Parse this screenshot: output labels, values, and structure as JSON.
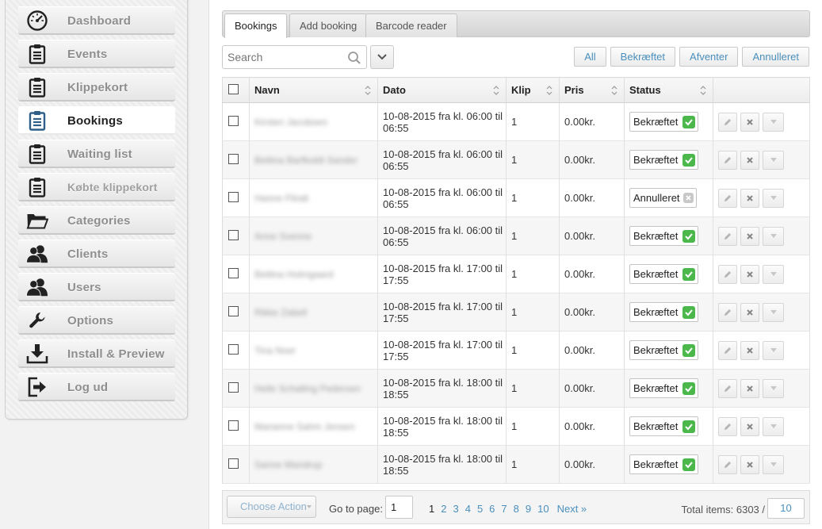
{
  "sidebar": {
    "items": [
      {
        "label": "Dashboard",
        "icon": "speedometer-icon"
      },
      {
        "label": "Events",
        "icon": "clipboard-icon"
      },
      {
        "label": "Klippekort",
        "icon": "clipboard-icon"
      },
      {
        "label": "Bookings",
        "icon": "clipboard-icon"
      },
      {
        "label": "Waiting list",
        "icon": "clipboard-icon"
      },
      {
        "label": "Købte klippekort",
        "icon": "clipboard-icon"
      },
      {
        "label": "Categories",
        "icon": "folder-icon"
      },
      {
        "label": "Clients",
        "icon": "users-icon"
      },
      {
        "label": "Users",
        "icon": "users-icon"
      },
      {
        "label": "Options",
        "icon": "wrench-icon"
      },
      {
        "label": "Install & Preview",
        "icon": "download-icon"
      },
      {
        "label": "Log ud",
        "icon": "logout-icon"
      }
    ],
    "active": "Bookings"
  },
  "tabs": [
    "Bookings",
    "Add booking",
    "Barcode reader"
  ],
  "search": {
    "placeholder": "Search",
    "value": ""
  },
  "filters": [
    "All",
    "Bekræftet",
    "Afventer",
    "Annulleret"
  ],
  "table": {
    "headers": {
      "name": "Navn",
      "date": "Dato",
      "klip": "Klip",
      "price": "Pris",
      "status": "Status"
    },
    "rows": [
      {
        "name": "Kirsten Jacobsen",
        "date_line1": "10-08-2015 fra kl. 06:00 til",
        "date_line2": "06:55",
        "klip": "1",
        "price": "0.00kr.",
        "status": "Bekræftet"
      },
      {
        "name": "Bettina Barfkoldt Sander",
        "date_line1": "10-08-2015 fra kl. 06:00 til",
        "date_line2": "06:55",
        "klip": "1",
        "price": "0.00kr.",
        "status": "Bekræftet"
      },
      {
        "name": "Hanne Flindt",
        "date_line1": "10-08-2015 fra kl. 06:00 til",
        "date_line2": "06:55",
        "klip": "1",
        "price": "0.00kr.",
        "status": "Annulleret"
      },
      {
        "name": "Anne Svenne",
        "date_line1": "10-08-2015 fra kl. 06:00 til",
        "date_line2": "06:55",
        "klip": "1",
        "price": "0.00kr.",
        "status": "Bekræftet"
      },
      {
        "name": "Bettina Holmgaard",
        "date_line1": "10-08-2015 fra kl. 17:00 til",
        "date_line2": "17:55",
        "klip": "1",
        "price": "0.00kr.",
        "status": "Bekræftet"
      },
      {
        "name": "Rikke Zabell",
        "date_line1": "10-08-2015 fra kl. 17:00 til",
        "date_line2": "17:55",
        "klip": "1",
        "price": "0.00kr.",
        "status": "Bekræftet"
      },
      {
        "name": "Tina Noer",
        "date_line1": "10-08-2015 fra kl. 17:00 til",
        "date_line2": "17:55",
        "klip": "1",
        "price": "0.00kr.",
        "status": "Bekræftet"
      },
      {
        "name": "Helle Schalling Pedersen",
        "date_line1": "10-08-2015 fra kl. 18:00 til",
        "date_line2": "18:55",
        "klip": "1",
        "price": "0.00kr.",
        "status": "Bekræftet"
      },
      {
        "name": "Marianne Sahm Jensen",
        "date_line1": "10-08-2015 fra kl. 18:00 til",
        "date_line2": "18:55",
        "klip": "1",
        "price": "0.00kr.",
        "status": "Bekræftet"
      },
      {
        "name": "Sanne Mandrup",
        "date_line1": "10-08-2015 fra kl. 18:00 til",
        "date_line2": "18:55",
        "klip": "1",
        "price": "0.00kr.",
        "status": "Bekræftet"
      }
    ]
  },
  "pager": {
    "choose_action": "Choose Action",
    "goto_label": "Go to page:",
    "goto_value": "1",
    "pages": [
      "1",
      "2",
      "3",
      "4",
      "5",
      "6",
      "7",
      "8",
      "9",
      "10"
    ],
    "current": "1",
    "next": "Next »",
    "total": "Total items: 6303 /",
    "per_page": "10"
  },
  "colors": {
    "accent": "#4a8fbd",
    "confirmed": "#4cb84c",
    "cancelled": "#c8c8c8"
  }
}
